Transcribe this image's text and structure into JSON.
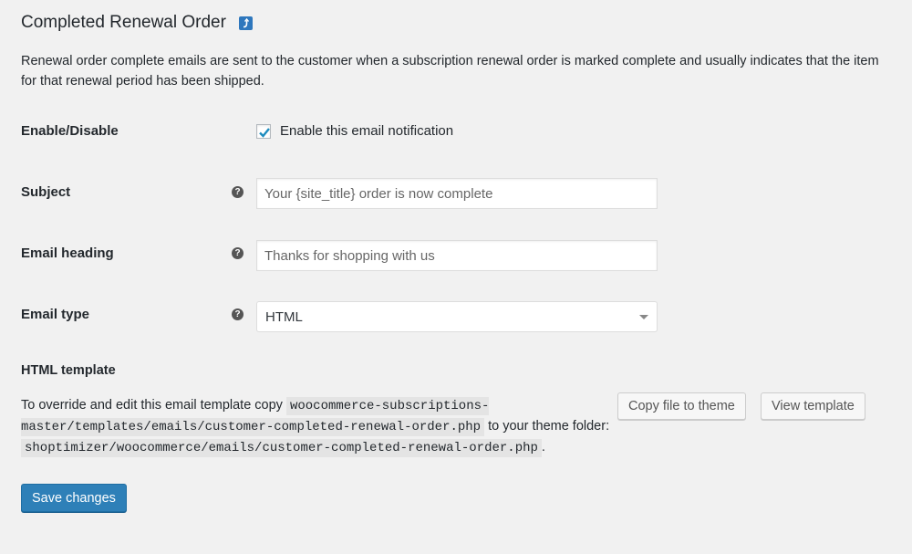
{
  "header": {
    "title": "Completed Renewal Order",
    "back_link_icon": "return-arrow-icon"
  },
  "description": "Renewal order complete emails are sent to the customer when a subscription renewal order is marked complete and usually indicates that the item for that renewal period has been shipped.",
  "fields": {
    "enable": {
      "label": "Enable/Disable",
      "checkbox_label": "Enable this email notification",
      "checked": true
    },
    "subject": {
      "label": "Subject",
      "value": "",
      "placeholder": "Your {site_title} order is now complete",
      "help_icon": "question-circle-icon"
    },
    "heading": {
      "label": "Email heading",
      "value": "",
      "placeholder": "Thanks for shopping with us",
      "help_icon": "question-circle-icon"
    },
    "email_type": {
      "label": "Email type",
      "selected": "HTML",
      "help_icon": "question-circle-icon"
    }
  },
  "template": {
    "heading": "HTML template",
    "text_1": "To override and edit this email template copy ",
    "code_1": "woocommerce-subscriptions-master/templates/emails/customer-completed-renewal-order.php",
    "text_2": " to your theme folder: ",
    "code_2": "shoptimizer/woocommerce/emails/customer-completed-renewal-order.php",
    "text_3": ".",
    "copy_button": "Copy file to theme",
    "view_button": "View template"
  },
  "footer": {
    "save_button": "Save changes"
  },
  "colors": {
    "background": "#f1f1f1",
    "primary": "#2e80b8",
    "checkmark": "#1e8cbe"
  }
}
